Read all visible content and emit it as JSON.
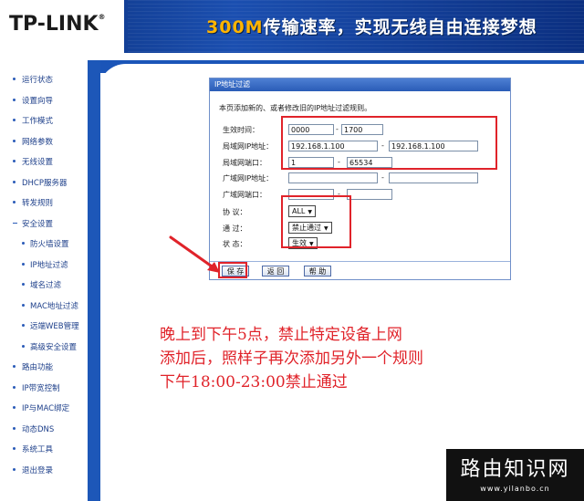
{
  "header": {
    "logo": "TP-LINK",
    "logo_mark": "®",
    "slogan_highlight": "300M",
    "slogan_rest": "传输速率，实现无线自由连接梦想"
  },
  "sidebar": {
    "items": [
      {
        "label": "运行状态",
        "type": "item"
      },
      {
        "label": "设置向导",
        "type": "item"
      },
      {
        "label": "工作模式",
        "type": "item"
      },
      {
        "label": "网络参数",
        "type": "item"
      },
      {
        "label": "无线设置",
        "type": "item"
      },
      {
        "label": "DHCP服务器",
        "type": "item"
      },
      {
        "label": "转发规则",
        "type": "item"
      },
      {
        "label": "安全设置",
        "type": "group"
      },
      {
        "label": "防火墙设置",
        "type": "sub"
      },
      {
        "label": "IP地址过滤",
        "type": "sub"
      },
      {
        "label": "域名过滤",
        "type": "sub"
      },
      {
        "label": "MAC地址过滤",
        "type": "sub"
      },
      {
        "label": "远端WEB管理",
        "type": "sub"
      },
      {
        "label": "高级安全设置",
        "type": "sub"
      },
      {
        "label": "路由功能",
        "type": "item"
      },
      {
        "label": "IP带宽控制",
        "type": "item"
      },
      {
        "label": "IP与MAC绑定",
        "type": "item"
      },
      {
        "label": "动态DNS",
        "type": "item"
      },
      {
        "label": "系统工具",
        "type": "item"
      },
      {
        "label": "退出登录",
        "type": "item"
      }
    ]
  },
  "panel": {
    "title": "IP地址过滤",
    "description": "本页添加新的、或者修改旧的IP地址过滤规则。",
    "fields": {
      "time_label": "生效时间：",
      "time_start": "0000",
      "time_end": "1700",
      "lan_ip_label": "局域网IP地址：",
      "lan_ip_start": "192.168.1.100",
      "lan_ip_end": "192.168.1.100",
      "lan_port_label": "局域网端口：",
      "lan_port_start": "1",
      "lan_port_end": "65534",
      "wan_ip_label": "广域网IP地址：",
      "wan_ip_start": "",
      "wan_ip_end": "",
      "wan_port_label": "广域网端口：",
      "wan_port_start": "",
      "wan_port_end": "",
      "protocol_label": "协 议：",
      "protocol_value": "ALL",
      "pass_label": "通 过：",
      "pass_value": "禁止通过",
      "status_label": "状 态：",
      "status_value": "生效",
      "dash": "-"
    },
    "buttons": {
      "save": "保 存",
      "back": "返 回",
      "help": "帮 助"
    }
  },
  "caption": {
    "line1": "晚上到下午5点，禁止特定设备上网",
    "line2": "添加后，照样子再次添加另外一个规则",
    "line3": "下午18:00-23:00禁止通过"
  },
  "watermark": {
    "title": "路由知识网",
    "url": "www.yilanbo.cn"
  },
  "colors": {
    "header_blue": "#1b4fb0",
    "accent_red": "#e0232a",
    "slogan_orange": "#ffb400"
  }
}
